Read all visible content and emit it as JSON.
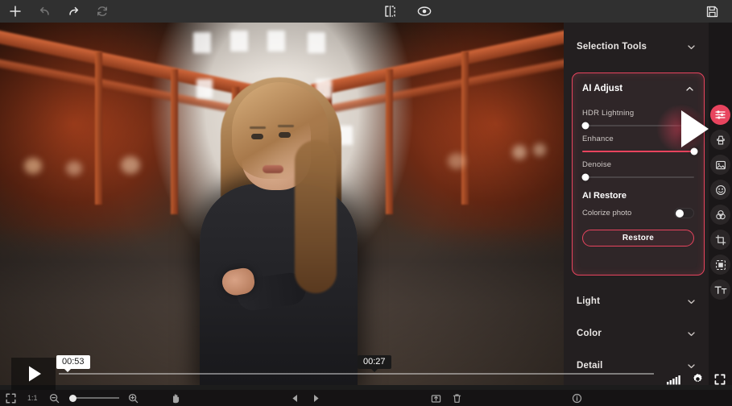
{
  "app": {
    "accent_color": "#e8445e",
    "panel_bg": "#231f20",
    "toolbar_bg": "#303030"
  },
  "toolbar": {
    "left": [
      {
        "name": "add-icon",
        "label": "Add",
        "enabled": true
      },
      {
        "name": "undo-icon",
        "label": "Undo",
        "enabled": false
      },
      {
        "name": "redo-icon",
        "label": "Redo",
        "enabled": true
      },
      {
        "name": "reset-icon",
        "label": "Reset",
        "enabled": false
      }
    ],
    "center": [
      {
        "name": "compare-split-icon",
        "label": "Compare"
      },
      {
        "name": "preview-eye-icon",
        "label": "Preview"
      }
    ],
    "right": [
      {
        "name": "save-icon",
        "label": "Save"
      }
    ]
  },
  "panel": {
    "selection_tools": {
      "label": "Selection Tools",
      "expanded": false
    },
    "ai_adjust": {
      "label": "AI Adjust",
      "expanded": true,
      "highlighted": true,
      "sliders": [
        {
          "label": "HDR Lightning",
          "value": 0,
          "percent": 0
        },
        {
          "label": "Enhance",
          "value": 100,
          "percent": 100
        },
        {
          "label": "Denoise",
          "value": 0,
          "percent": 0
        }
      ],
      "ai_restore": {
        "label": "AI Restore",
        "toggle_label": "Colorize photo",
        "toggle_on": false,
        "button_label": "Restore"
      }
    },
    "sections": [
      {
        "label": "Light",
        "expanded": false
      },
      {
        "label": "Color",
        "expanded": false
      },
      {
        "label": "Detail",
        "expanded": false
      }
    ]
  },
  "rail": [
    {
      "name": "adjust-sliders-icon",
      "label": "Adjust",
      "active": true
    },
    {
      "name": "stamp-icon",
      "label": "Retouch",
      "active": false
    },
    {
      "name": "image-icon",
      "label": "Overlay",
      "active": false
    },
    {
      "name": "smiley-icon",
      "label": "Portrait",
      "active": false
    },
    {
      "name": "color-wheel-icon",
      "label": "Color",
      "active": false
    },
    {
      "name": "crop-icon",
      "label": "Crop",
      "active": false
    },
    {
      "name": "transform-icon",
      "label": "Transform",
      "active": false
    },
    {
      "name": "text-icon",
      "label": "Text",
      "active": false
    }
  ],
  "video": {
    "play_label": "Play",
    "hover_time": "00:53",
    "current_time": "00:27",
    "progress_percent": 0,
    "controls": [
      {
        "name": "volume-icon",
        "label": "Volume"
      },
      {
        "name": "settings-icon",
        "label": "Settings"
      },
      {
        "name": "fullscreen-icon",
        "label": "Fullscreen"
      }
    ]
  },
  "bottombar": {
    "fit_label": "Fit to screen",
    "actual_size_label": "1:1",
    "zoom_out_label": "Zoom out",
    "zoom_in_label": "Zoom in",
    "brightness_value": 0,
    "hand_label": "Pan",
    "prev_label": "Previous",
    "next_label": "Next",
    "export_label": "Export",
    "delete_label": "Delete",
    "info_label": "Info"
  }
}
